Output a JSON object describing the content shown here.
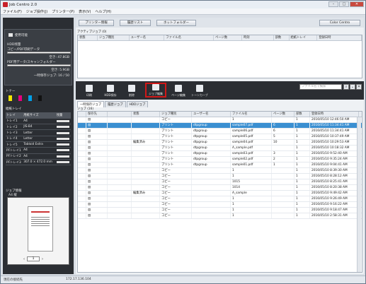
{
  "window": {
    "title": "Job Centro 2.0"
  },
  "menu": [
    "ファイル(F)",
    "ジョブ操作(J)",
    "プリンター(P)",
    "表示(V)",
    "ヘルプ(H)"
  ],
  "left": {
    "status": "使用可能",
    "hdd_label": "HDD残量",
    "copy_label": "コピー/PDF印刷データ",
    "copy_free": "空き: 47.8GB",
    "pdf_label": "PDF用データ/スキャンフォルダー",
    "pdf_free": "空き: 5.9GB",
    "secure_label": "一時保存ジョブ: 16 / 50",
    "toner_label": "トナー",
    "toner_colors": [
      "#f2e600",
      "#e6007e",
      "#00a0e9",
      "#111111"
    ],
    "tray_label": "給紙トレイ",
    "tray_headers": [
      "トレイ",
      "用紙サイズ",
      "残量"
    ],
    "trays": [
      [
        "トレイ1",
        "A4"
      ],
      [
        "トレイ2",
        "JIS-B4"
      ],
      [
        "トレイ3",
        "Letter"
      ],
      [
        "トレイ4",
        "Letter"
      ],
      [
        "トレイ5",
        "Tabloid Extra"
      ],
      [
        "PFトレイ1",
        "A4"
      ],
      [
        "PFトレイ2",
        "A4"
      ],
      [
        "PFトレイ3",
        "307.0 × 472.0 mm"
      ]
    ],
    "job_info_label": "ジョブ情報",
    "job_info_size": "A4 縦",
    "page_number": "1"
  },
  "top_buttons": [
    "プリンター情報",
    "履歴リスト",
    "ホットフォルダー"
  ],
  "brand_button": "Color Centro",
  "active_jobs": {
    "title": "アクティブジョブ (0)",
    "headers": [
      "状態",
      "ジョブ種別",
      "ユーザー名",
      "ファイル名",
      "ページ数",
      "時刻",
      "部数",
      "給紙トレイ",
      "登録日時"
    ]
  },
  "toolbar": {
    "buttons": [
      "印刷",
      "HDD保存",
      "削除",
      "ジョブ編集",
      "ページ編集",
      "トーンカーブ"
    ],
    "search_placeholder": "ファイル名で検索"
  },
  "tabs": [
    "一時保存ジョブ",
    "履歴ジョブ",
    "HDDジョブ"
  ],
  "jobs": {
    "title": "ジョブ (16)",
    "headers": [
      "",
      "保存先",
      "",
      "状態",
      "ジョブ種別",
      "ユーザー名",
      "ファイル名",
      "ページ数",
      "部数",
      "登録日時"
    ],
    "rows": [
      [
        "",
        "",
        "",
        "コピー",
        "",
        "1",
        "",
        "1",
        "2016/05/10 12:46:50 AM"
      ],
      [
        "",
        "",
        "",
        "プリント",
        "dtpgroup",
        "sample07.pdf",
        "6",
        "1",
        "2016/05/10 11:34:41 AM"
      ],
      [
        "",
        "",
        "",
        "プリント",
        "dtpgroup",
        "sample06.pdf",
        "6",
        "1",
        "2016/05/10 11:34:41 AM"
      ],
      [
        "",
        "",
        "",
        "プリント",
        "dtpgroup",
        "sample05.pdf",
        "5",
        "1",
        "2016/05/10 10:37:49 AM"
      ],
      [
        "",
        "",
        "編集済み",
        "プリント",
        "dtpgroup",
        "sample04.pdf",
        "10",
        "1",
        "2016/05/10 10:29:53 AM"
      ],
      [
        "",
        "",
        "",
        "プリント",
        "dtpgroup",
        "A_sample.pdf",
        "",
        "1",
        "2016/05/10 10:18:32 AM"
      ],
      [
        "",
        "",
        "",
        "プリント",
        "dtpgroup",
        "sample03.pdf",
        "3",
        "1",
        "2016/05/10 9:52:40 AM"
      ],
      [
        "",
        "",
        "",
        "プリント",
        "dtpgroup",
        "sample02.pdf",
        "2",
        "1",
        "2016/05/10 9:35:24 AM"
      ],
      [
        "",
        "",
        "",
        "プリント",
        "dtpgroup",
        "sample01.pdf",
        "1",
        "1",
        "2016/05/10 9:04:41 AM"
      ],
      [
        "",
        "",
        "",
        "コピー",
        "",
        "1",
        "",
        "1",
        "2016/05/10 8:39:30 AM"
      ],
      [
        "",
        "",
        "",
        "コピー",
        "",
        "1",
        "",
        "1",
        "2016/05/10 8:28:12 AM"
      ],
      [
        "",
        "",
        "",
        "コピー",
        "",
        "1015",
        "",
        "1",
        "2016/05/10 8:25:41 AM"
      ],
      [
        "",
        "",
        "",
        "コピー",
        "",
        "1014",
        "",
        "1",
        "2016/05/10 8:20:38 AM"
      ],
      [
        "",
        "",
        "編集済み",
        "コピー",
        "",
        "A_sample",
        "",
        "1",
        "2016/05/10 9:49:42 AM"
      ],
      [
        "",
        "",
        "",
        "コピー",
        "",
        "1",
        "",
        "1",
        "2016/05/10 9:26:49 AM"
      ],
      [
        "",
        "",
        "",
        "コピー",
        "",
        "1",
        "",
        "1",
        "2016/05/10 9:16:22 AM"
      ],
      [
        "",
        "",
        "",
        "コピー",
        "",
        "1",
        "",
        "1",
        "2016/05/10 9:18:47 AM"
      ],
      [
        "",
        "",
        "",
        "コピー",
        "",
        "1",
        "",
        "1",
        "2016/05/10 2:58:31 AM"
      ]
    ]
  },
  "status": {
    "left": "現在の接続先",
    "ip": "172.17.136.104"
  }
}
